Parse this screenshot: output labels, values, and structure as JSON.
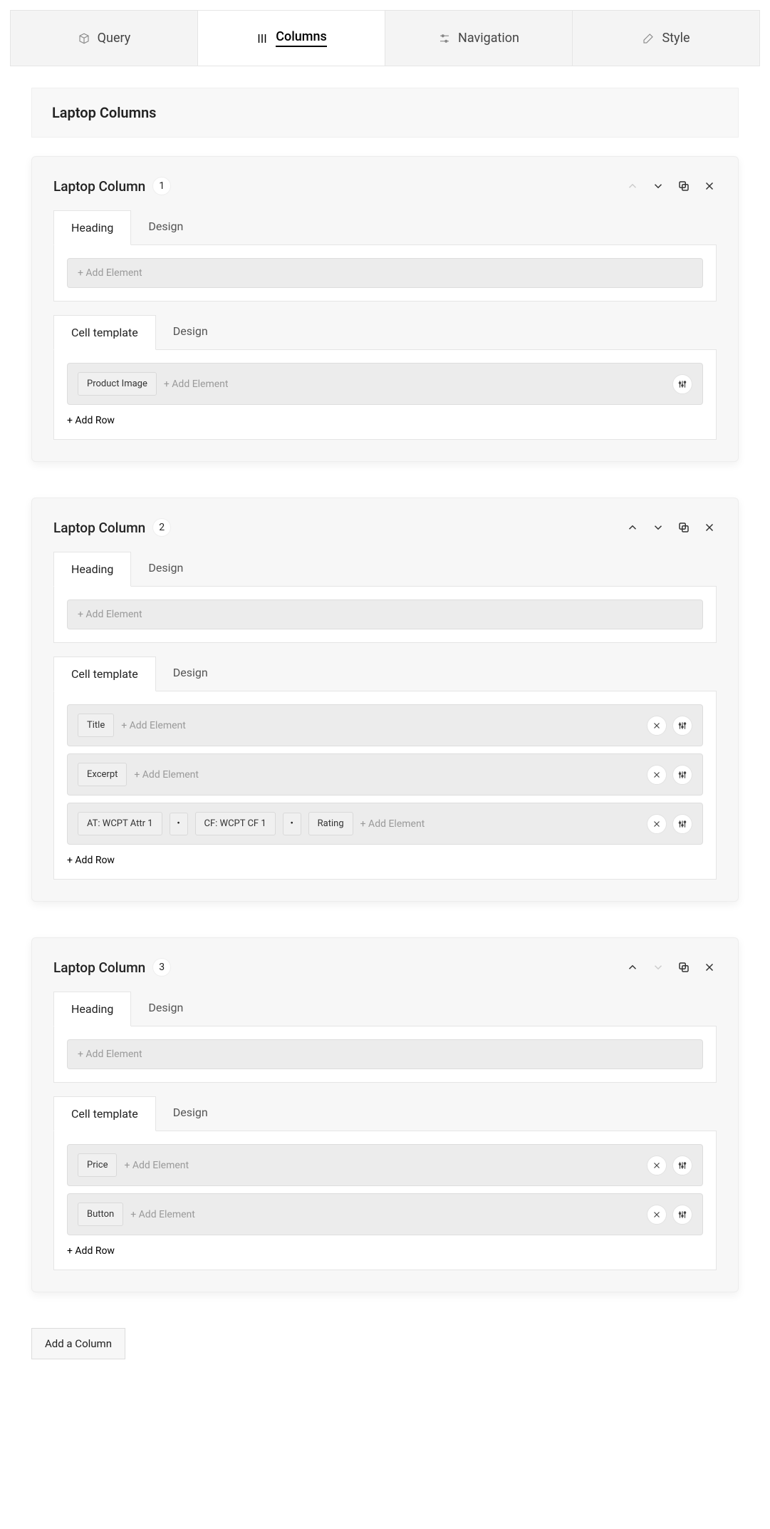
{
  "topTabs": {
    "query": "Query",
    "columns": "Columns",
    "navigation": "Navigation",
    "style": "Style"
  },
  "sectionTitle": "Laptop Columns",
  "subTabs": {
    "heading": "Heading",
    "design": "Design",
    "cellTemplate": "Cell template"
  },
  "placeholders": {
    "addElement": "+ Add Element",
    "addRow": "+ Add Row"
  },
  "columns": [
    {
      "title": "Laptop Column",
      "index": "1",
      "moveUpDisabled": true,
      "moveDownDisabled": false,
      "cellRows": [
        {
          "chips": [
            "Product Image"
          ],
          "hasDelete": false
        }
      ]
    },
    {
      "title": "Laptop Column",
      "index": "2",
      "moveUpDisabled": false,
      "moveDownDisabled": false,
      "cellRows": [
        {
          "chips": [
            "Title"
          ],
          "hasDelete": true
        },
        {
          "chips": [
            "Excerpt"
          ],
          "hasDelete": true
        },
        {
          "chips": [
            "AT: WCPT Attr 1",
            "•",
            "CF: WCPT CF 1",
            "•",
            "Rating"
          ],
          "hasDelete": true
        }
      ]
    },
    {
      "title": "Laptop Column",
      "index": "3",
      "moveUpDisabled": false,
      "moveDownDisabled": true,
      "cellRows": [
        {
          "chips": [
            "Price"
          ],
          "hasDelete": true
        },
        {
          "chips": [
            "Button"
          ],
          "hasDelete": true
        }
      ]
    }
  ],
  "addColumnLabel": "Add a Column"
}
